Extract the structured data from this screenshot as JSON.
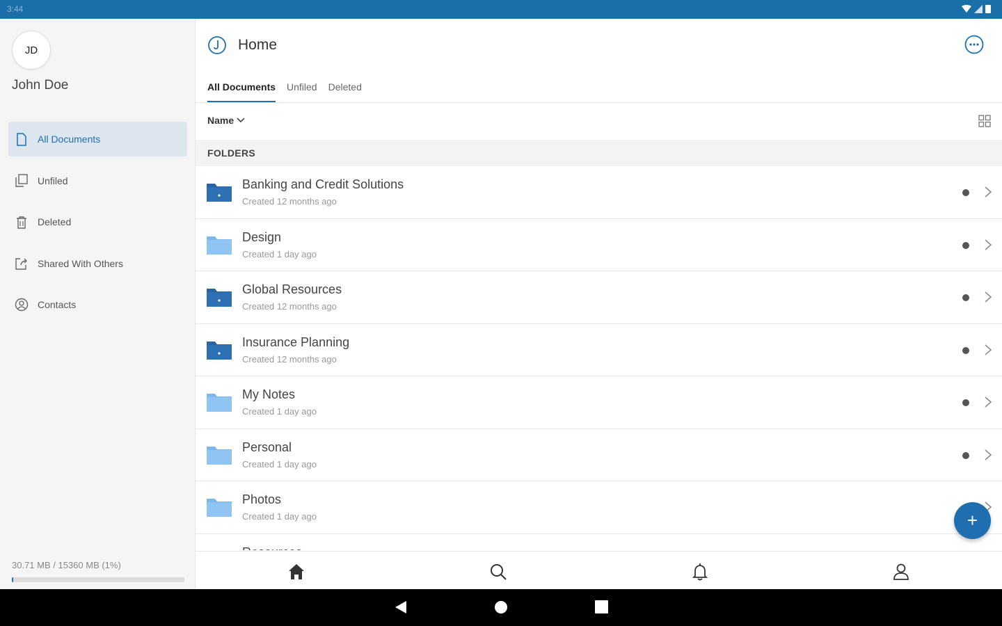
{
  "status_bar": {
    "time": "3:44"
  },
  "user": {
    "initials": "JD",
    "name": "John Doe"
  },
  "sidebar": {
    "items": [
      {
        "label": "All Documents",
        "icon": "document-icon",
        "active": true
      },
      {
        "label": "Unfiled",
        "icon": "copy-icon",
        "active": false
      },
      {
        "label": "Deleted",
        "icon": "trash-icon",
        "active": false
      },
      {
        "label": "Shared With Others",
        "icon": "share-icon",
        "active": false
      },
      {
        "label": "Contacts",
        "icon": "contacts-icon",
        "active": false
      }
    ],
    "storage_text": "30.71 MB / 15360 MB (1%)",
    "storage_fraction": 0.01
  },
  "header": {
    "title": "Home"
  },
  "tabs": [
    {
      "label": "All Documents",
      "active": true
    },
    {
      "label": "Unfiled",
      "active": false
    },
    {
      "label": "Deleted",
      "active": false
    }
  ],
  "sort": {
    "label": "Name"
  },
  "section": {
    "label": "FOLDERS"
  },
  "folders": [
    {
      "name": "Banking and Credit Solutions",
      "created": "Created 12 months ago",
      "shared": true
    },
    {
      "name": "Design",
      "created": "Created 1 day ago",
      "shared": false
    },
    {
      "name": "Global Resources",
      "created": "Created 12 months ago",
      "shared": true
    },
    {
      "name": "Insurance Planning",
      "created": "Created 12 months ago",
      "shared": true
    },
    {
      "name": "My Notes",
      "created": "Created 1 day ago",
      "shared": false
    },
    {
      "name": "Personal",
      "created": "Created 1 day ago",
      "shared": false
    },
    {
      "name": "Photos",
      "created": "Created 1 day ago",
      "shared": false
    },
    {
      "name": "Resources",
      "created": "",
      "shared": false
    }
  ],
  "fab": {
    "label": "+"
  },
  "colors": {
    "brand": "#1f6fb0",
    "status_bar": "#1b6fa8",
    "folder_dark": "#2f6fb4",
    "folder_light": "#90c4f2"
  }
}
